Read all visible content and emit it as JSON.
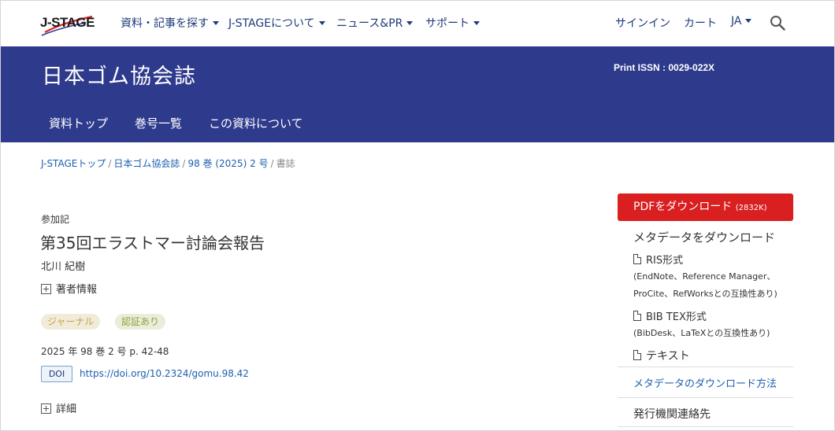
{
  "header": {
    "logo_text": "J-STAGE",
    "nav": [
      {
        "label": "資料・記事を探す"
      },
      {
        "label": "J-STAGEについて"
      },
      {
        "label": "ニュース&PR"
      },
      {
        "label": "サポート"
      }
    ],
    "signin": "サインイン",
    "cart": "カート",
    "lang": "JA",
    "search_icon": "search-icon"
  },
  "banner": {
    "journal_title": "日本ゴム協会誌",
    "issn": "Print ISSN : 0029-022X",
    "subnav": [
      "資料トップ",
      "巻号一覧",
      "この資料について"
    ]
  },
  "breadcrumb": {
    "items": [
      "J-STAGEトップ",
      "日本ゴム協会誌",
      "98 巻 (2025) 2 号"
    ],
    "current": "書誌"
  },
  "article": {
    "category": "参加記",
    "title": "第35回エラストマー討論会報告",
    "author": "北川 紀樹",
    "author_info": "著者情報",
    "badges": {
      "journal": "ジャーナル",
      "peer": "認証あり"
    },
    "pub_info": "2025 年 98 巻 2 号 p. 42-48",
    "doi_label": "DOI",
    "doi_url": "https://doi.org/10.2324/gomu.98.42",
    "details": "詳細"
  },
  "sidebar": {
    "pdf_label": "PDFをダウンロード",
    "pdf_size": "(2832K)",
    "meta_title": "メタデータをダウンロード",
    "ris_label": "RIS形式",
    "ris_desc1": "(EndNote、Reference Manager、",
    "ris_desc2": "ProCite、RefWorksとの互換性あり)",
    "bib_label": "BIB TEX形式",
    "bib_desc": "(BibDesk、LaTeXとの互換性あり)",
    "text_label": "テキスト",
    "meta_method": "メタデータのダウンロード方法",
    "publisher": "発行機関連絡先"
  },
  "colors": {
    "banner": "#2e3a8c",
    "pdf_button": "#d91f1f",
    "link": "#1d5fb0"
  }
}
